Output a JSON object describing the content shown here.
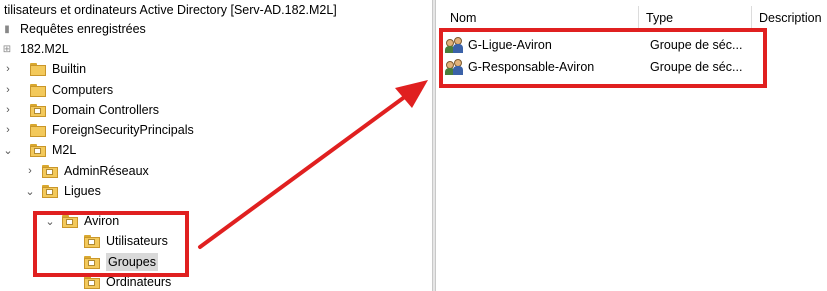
{
  "tree": {
    "title": "tilisateurs et ordinateurs Active Directory [Serv-AD.182.M2L]",
    "saved_queries": "Requêtes enregistrées",
    "domain": "182.M2L",
    "items": {
      "builtin": "Builtin",
      "computers": "Computers",
      "domain_controllers": "Domain Controllers",
      "fsp": "ForeignSecurityPrincipals",
      "m2l": "M2L",
      "admin_reseaux": "AdminRéseaux",
      "ligues": "Ligues",
      "aviron": "Aviron",
      "utilisateurs": "Utilisateurs",
      "groupes": "Groupes",
      "ordinateurs": "Ordinateurs"
    }
  },
  "listview": {
    "columns": [
      "Nom",
      "Type",
      "Description"
    ],
    "rows": [
      {
        "name": "G-Ligue-Aviron",
        "type": "Groupe de séc...",
        "icon": "group-icon"
      },
      {
        "name": "G-Responsable-Aviron",
        "type": "Groupe de séc...",
        "icon": "group-icon"
      }
    ]
  },
  "annotation": {
    "highlight_color": "#e02020"
  }
}
